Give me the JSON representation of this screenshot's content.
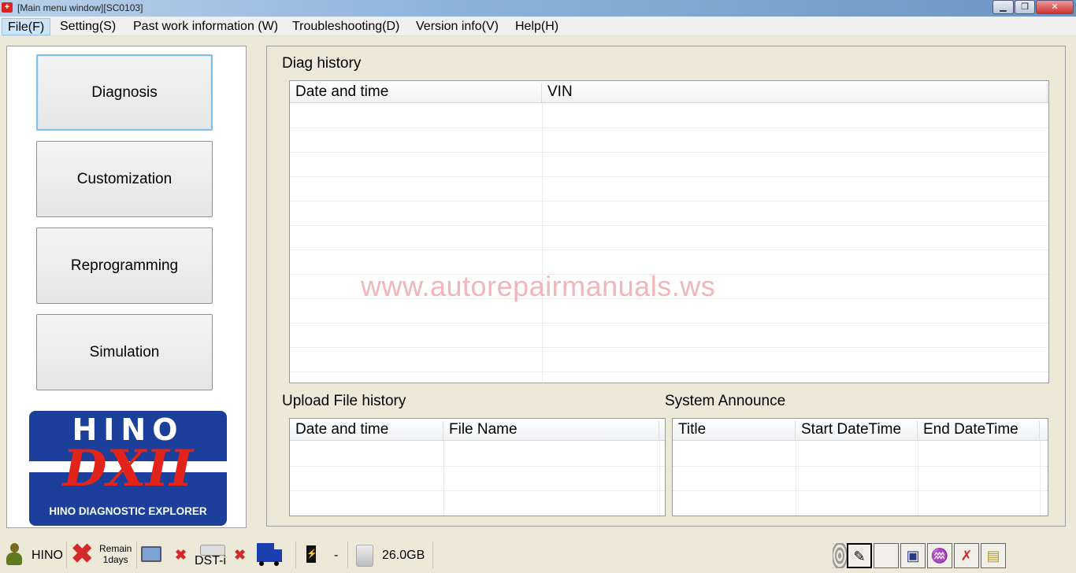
{
  "window": {
    "title": "[Main menu window][SC0103]",
    "minimize": "▁",
    "restore": "❐",
    "close": "✕"
  },
  "menu": [
    "File(F)",
    "Setting(S)",
    "Past work information (W)",
    "Troubleshooting(D)",
    "Version info(V)",
    "Help(H)"
  ],
  "nav": {
    "diagnosis": "Diagnosis",
    "customization": "Customization",
    "reprogramming": "Reprogramming",
    "simulation": "Simulation"
  },
  "logo": {
    "brand": "HINO",
    "product": "DXII",
    "tagline": "HINO DIAGNOSTIC EXPLORER"
  },
  "diag_history": {
    "title": "Diag history",
    "columns": [
      "Date and time",
      "VIN"
    ],
    "rows": []
  },
  "upload_history": {
    "title": "Upload File history",
    "columns": [
      "Date and time",
      "File Name"
    ],
    "rows": []
  },
  "system_announce": {
    "title": "System Announce",
    "columns": [
      "Title",
      "Start DateTime",
      "End DateTime"
    ],
    "rows": []
  },
  "watermark": "www.autorepairmanuals.ws",
  "status": {
    "user": "HINO",
    "license_line1": "Remain",
    "license_line2": "1days",
    "device": "DST-i",
    "battery": "-",
    "disk": "26.0GB"
  },
  "colors": {
    "accent": "#1b3f9a",
    "logo_red": "#e2231a",
    "error": "#d62828"
  }
}
